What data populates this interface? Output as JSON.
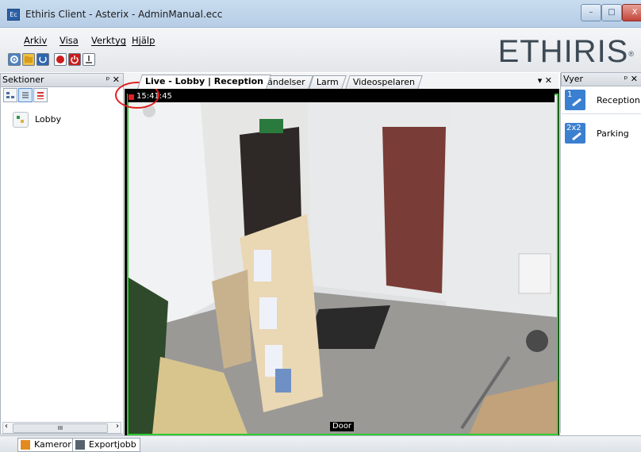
{
  "window": {
    "title": "Ethiris Client - Asterix - AdminManual.ecc",
    "app_icon": "Ec",
    "controls": {
      "minimize": "–",
      "maximize": "□",
      "close": "X"
    }
  },
  "menu": {
    "items": [
      {
        "label": "Arkiv"
      },
      {
        "label": "Visa"
      },
      {
        "label": "Verktyg"
      },
      {
        "label": "Hjälp"
      }
    ]
  },
  "brand": {
    "text": "ETHIRIS",
    "mark": "®"
  },
  "toolbar": {
    "icons": [
      "settings-icon",
      "folder-icon",
      "refresh-icon",
      "record-icon",
      "power-icon",
      "export-icon"
    ]
  },
  "sections_panel": {
    "title": "Sektioner",
    "controls": "ᵖ ✕",
    "items": [
      {
        "label": "Lobby"
      }
    ],
    "scroll_thumb": "III"
  },
  "tabs": {
    "items": [
      {
        "label": "Live - Lobby | Reception",
        "active": true
      },
      {
        "label": "Händelser",
        "active": false
      },
      {
        "label": "Larm",
        "active": false
      },
      {
        "label": "Videospelaren",
        "active": false
      }
    ],
    "controls": "▾ ✕"
  },
  "video": {
    "timestamp": "15:41:45",
    "camera_label": "Door",
    "border_color": "#2ecb2e"
  },
  "views_panel": {
    "title": "Vyer",
    "controls": "ᵖ ✕",
    "items": [
      {
        "badge": "1",
        "label": "Reception"
      },
      {
        "badge": "2x2",
        "label": "Parking"
      }
    ]
  },
  "bottom_tabs": [
    {
      "label": "Kameror"
    },
    {
      "label": "Exportjobb"
    }
  ],
  "colors": {
    "accent": "#2c5fa5",
    "video_border": "#2ecb2e",
    "highlight_circle": "#e02020"
  }
}
